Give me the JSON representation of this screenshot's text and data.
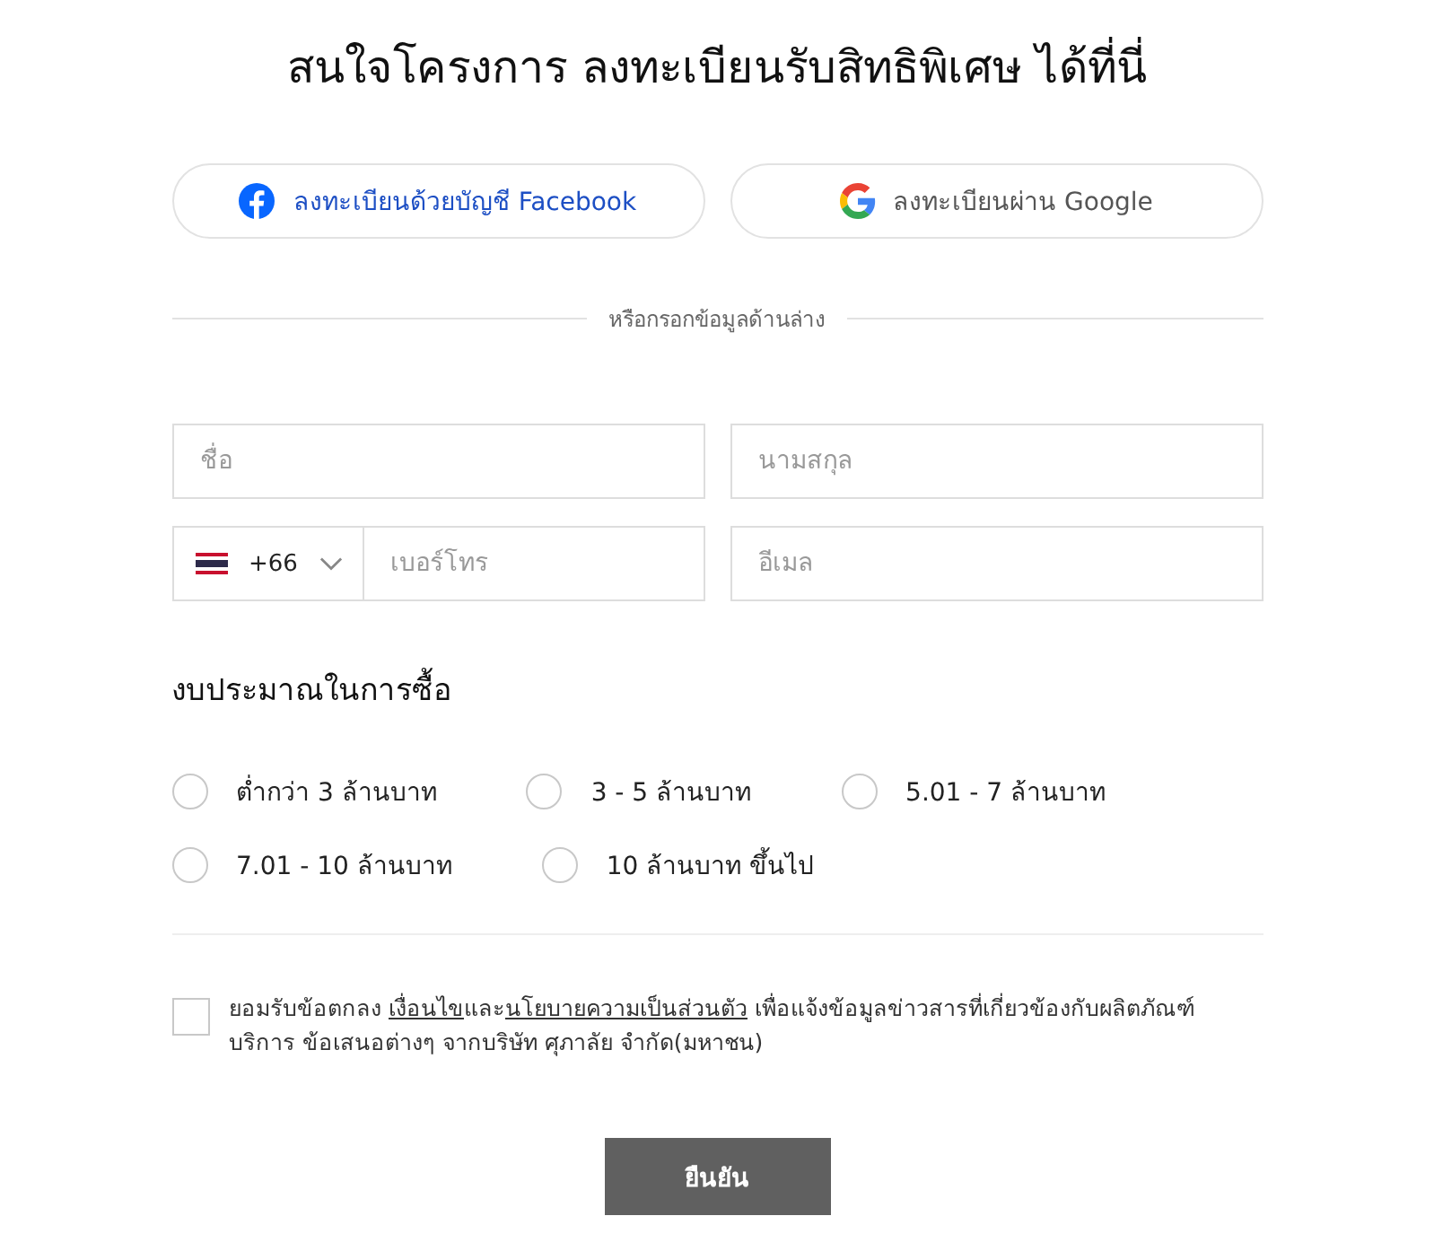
{
  "title": "สนใจโครงการ ลงทะเบียนรับสิทธิพิเศษ ได้ที่นี่",
  "social_buttons": [
    {
      "kind": "facebook",
      "label": "ลงทะเบียนด้วยบัญชี Facebook"
    },
    {
      "kind": "google",
      "label": "ลงทะเบียนผ่าน Google"
    }
  ],
  "divider_label": "หรือกรอกข้อมูลด้านล่าง",
  "fields": [
    {
      "kind": "text",
      "placeholder": "ชื่อ"
    },
    {
      "kind": "text",
      "placeholder": "นามสกุล"
    },
    {
      "kind": "phone",
      "country_code": "+66",
      "placeholder": "เบอร์โทร"
    },
    {
      "kind": "text",
      "placeholder": "อีเมล"
    }
  ],
  "budget": {
    "title": "งบประมาณในการซื้อ",
    "options": [
      {
        "label": "ต่ำกว่า 3 ล้านบาท",
        "selected": false
      },
      {
        "label": "3 - 5 ล้านบาท",
        "selected": false
      },
      {
        "label": "5.01 - 7 ล้านบาท",
        "selected": false
      },
      {
        "label": "7.01 - 10 ล้านบาท",
        "selected": false
      },
      {
        "label": "10 ล้านบาท ขึ้นไป",
        "selected": false
      }
    ]
  },
  "consent": {
    "checked": false,
    "parts": [
      {
        "kind": "text",
        "text": "ยอมรับข้อตกลง "
      },
      {
        "kind": "link",
        "text": "เงื่อนไข"
      },
      {
        "kind": "text",
        "text": "และ"
      },
      {
        "kind": "link",
        "text": "นโยบายความเป็นส่วนตัว"
      },
      {
        "kind": "text",
        "text": " เพื่อแจ้งข้อมูลข่าวสารที่เกี่ยวข้องกับผลิตภัณฑ์ บริการ ข้อเสนอต่างๆ จากบริษัท ศุภาลัย จำกัด(มหาชน)"
      }
    ]
  },
  "submit_button": "ยืนยัน"
}
